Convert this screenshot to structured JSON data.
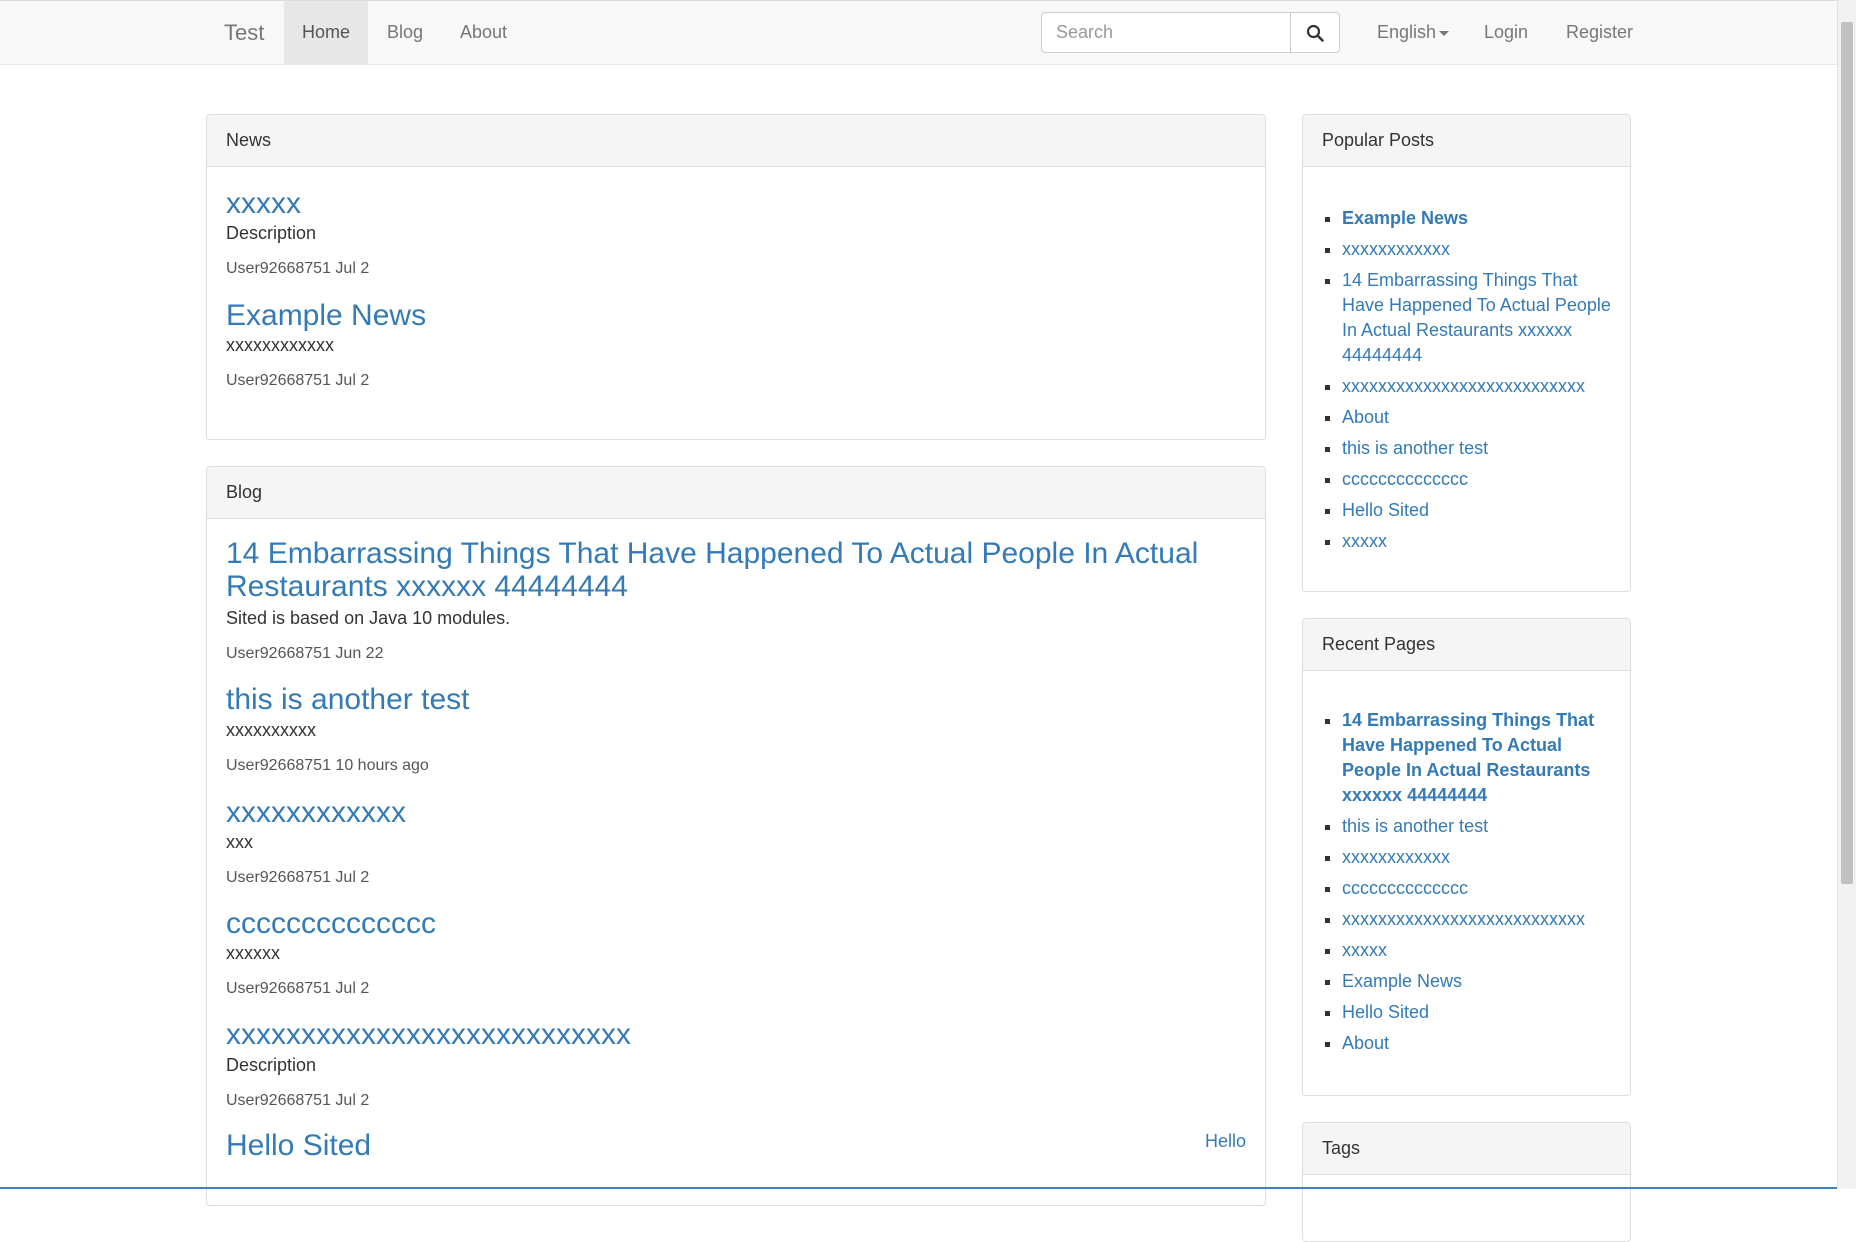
{
  "navbar": {
    "brand": "Test",
    "links": [
      {
        "label": "Home"
      },
      {
        "label": "Blog"
      },
      {
        "label": "About"
      }
    ],
    "search_placeholder": "Search",
    "language": "English",
    "login": "Login",
    "register": "Register"
  },
  "news": {
    "heading": "News",
    "posts": [
      {
        "title": "xxxxx",
        "description": "Description",
        "author": "User92668751",
        "date": "Jul 2"
      },
      {
        "title": "Example News",
        "description": "xxxxxxxxxxxx",
        "author": "User92668751",
        "date": "Jul 2"
      }
    ]
  },
  "blog": {
    "heading": "Blog",
    "posts": [
      {
        "title_line1": "14 Embarrassing Things That Have Happened To Actual People In Actual",
        "title_line2": "Restaurants xxxxxx 44444444",
        "description": "Sited is based on Java 10 modules.",
        "author": "User92668751",
        "date": "Jun 22"
      },
      {
        "title": "this is another test",
        "description": "xxxxxxxxxx",
        "author": "User92668751",
        "date": "10 hours ago"
      },
      {
        "title": "xxxxxxxxxxxx",
        "description": "xxx",
        "author": "User92668751",
        "date": "Jul 2"
      },
      {
        "title": "cccccccccccccc",
        "description": "xxxxxx",
        "author": "User92668751",
        "date": "Jul 2"
      },
      {
        "title": "xxxxxxxxxxxxxxxxxxxxxxxxxxx",
        "description": "Description",
        "author": "User92668751",
        "date": "Jul 2"
      },
      {
        "title": "Hello Sited",
        "tag": "Hello"
      }
    ]
  },
  "popular_posts": {
    "heading": "Popular Posts",
    "items": [
      "Example News",
      "xxxxxxxxxxxx",
      "14 Embarrassing Things That Have Happened To Actual People In Actual Restaurants xxxxxx 44444444",
      "xxxxxxxxxxxxxxxxxxxxxxxxxxx",
      "About",
      "this is another test",
      "cccccccccccccc",
      "Hello Sited",
      "xxxxx"
    ]
  },
  "recent_pages": {
    "heading": "Recent Pages",
    "items": [
      "14 Embarrassing Things That Have Happened To Actual People In Actual Restaurants xxxxxx 44444444",
      "this is another test",
      "xxxxxxxxxxxx",
      "cccccccccccccc",
      "xxxxxxxxxxxxxxxxxxxxxxxxxxx",
      "xxxxx",
      "Example News",
      "Hello Sited",
      "About"
    ]
  },
  "tags": {
    "heading": "Tags"
  },
  "colors": {
    "link": "#337ab7",
    "navbar_bg": "#f8f8f8",
    "panel_heading_bg": "#f5f5f5",
    "text": "#333333"
  }
}
